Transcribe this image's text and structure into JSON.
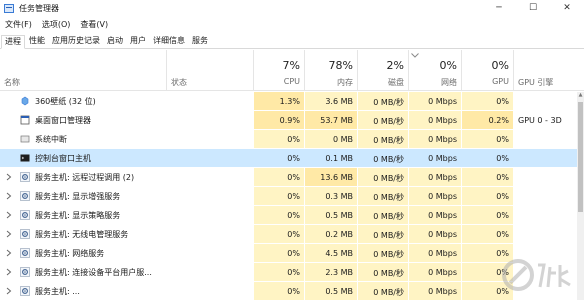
{
  "window": {
    "title": "任务管理器",
    "controls": {
      "minimize": "─",
      "maximize": "☐",
      "close": "✕"
    }
  },
  "menu": [
    "文件(F)",
    "选项(O)",
    "查看(V)"
  ],
  "tabs": [
    {
      "label": "进程",
      "active": true
    },
    {
      "label": "性能",
      "active": false
    },
    {
      "label": "应用历史记录",
      "active": false
    },
    {
      "label": "启动",
      "active": false
    },
    {
      "label": "用户",
      "active": false
    },
    {
      "label": "详细信息",
      "active": false
    },
    {
      "label": "服务",
      "active": false
    }
  ],
  "columns": {
    "name": {
      "label": "名称"
    },
    "status": {
      "label": "状态"
    },
    "cpu": {
      "pct": "7%",
      "label": "CPU"
    },
    "memory": {
      "pct": "78%",
      "label": "内存"
    },
    "disk": {
      "pct": "2%",
      "label": "磁盘"
    },
    "network": {
      "pct": "0%",
      "label": "网络"
    },
    "gpu": {
      "pct": "0%",
      "label": "GPU"
    },
    "gpu_engine": {
      "label": "GPU 引擎"
    }
  },
  "rows": [
    {
      "name": "360壁纸 (32 位)",
      "icon": "wallpaper-app-icon",
      "expandable": false,
      "cpu": "1.3%",
      "memory": "3.6 MB",
      "disk": "0 MB/秒",
      "network": "0 Mbps",
      "gpu": "0%",
      "gpu_engine": ""
    },
    {
      "name": "桌面窗口管理器",
      "icon": "window-manager-icon",
      "expandable": false,
      "cpu": "0.9%",
      "memory": "53.7 MB",
      "disk": "0 MB/秒",
      "network": "0 Mbps",
      "gpu": "0.2%",
      "gpu_engine": "GPU 0 - 3D"
    },
    {
      "name": "系统中断",
      "icon": "system-icon",
      "expandable": false,
      "cpu": "0%",
      "memory": "0 MB",
      "disk": "0 MB/秒",
      "network": "0 Mbps",
      "gpu": "0%",
      "gpu_engine": ""
    },
    {
      "name": "控制台窗口主机",
      "icon": "console-icon",
      "expandable": false,
      "cpu": "0%",
      "memory": "0.1 MB",
      "disk": "0 MB/秒",
      "network": "0 Mbps",
      "gpu": "0%",
      "gpu_engine": ""
    },
    {
      "name": "服务主机: 远程过程调用 (2)",
      "icon": "service-gear-icon",
      "expandable": true,
      "cpu": "0%",
      "memory": "13.6 MB",
      "disk": "0 MB/秒",
      "network": "0 Mbps",
      "gpu": "0%",
      "gpu_engine": ""
    },
    {
      "name": "服务主机: 显示增强服务",
      "icon": "service-gear-icon",
      "expandable": true,
      "cpu": "0%",
      "memory": "0.3 MB",
      "disk": "0 MB/秒",
      "network": "0 Mbps",
      "gpu": "0%",
      "gpu_engine": ""
    },
    {
      "name": "服务主机: 显示策略服务",
      "icon": "service-gear-icon",
      "expandable": true,
      "cpu": "0%",
      "memory": "0.5 MB",
      "disk": "0 MB/秒",
      "network": "0 Mbps",
      "gpu": "0%",
      "gpu_engine": ""
    },
    {
      "name": "服务主机: 无线电管理服务",
      "icon": "service-gear-icon",
      "expandable": true,
      "cpu": "0%",
      "memory": "0.2 MB",
      "disk": "0 MB/秒",
      "network": "0 Mbps",
      "gpu": "0%",
      "gpu_engine": ""
    },
    {
      "name": "服务主机: 网络服务",
      "icon": "service-gear-icon",
      "expandable": true,
      "cpu": "0%",
      "memory": "4.5 MB",
      "disk": "0 MB/秒",
      "network": "0 Mbps",
      "gpu": "0%",
      "gpu_engine": ""
    },
    {
      "name": "服务主机: 连接设备平台用户服...",
      "icon": "service-gear-icon",
      "expandable": true,
      "cpu": "0%",
      "memory": "2.3 MB",
      "disk": "0 MB/秒",
      "network": "0 Mbps",
      "gpu": "0%",
      "gpu_engine": ""
    },
    {
      "name": "服务主机: ...",
      "icon": "service-gear-icon",
      "expandable": true,
      "cpu": "0%",
      "memory": "0.5 MB",
      "disk": "0 MB/秒",
      "network": "0 Mbps",
      "gpu": "0%",
      "gpu_engine": ""
    }
  ],
  "selected_row": 3,
  "colors": {
    "heat_light": "#fff4c4",
    "heat_medium": "#ffe9a6",
    "selected": "#cce8ff",
    "accent": "#0078d7"
  }
}
